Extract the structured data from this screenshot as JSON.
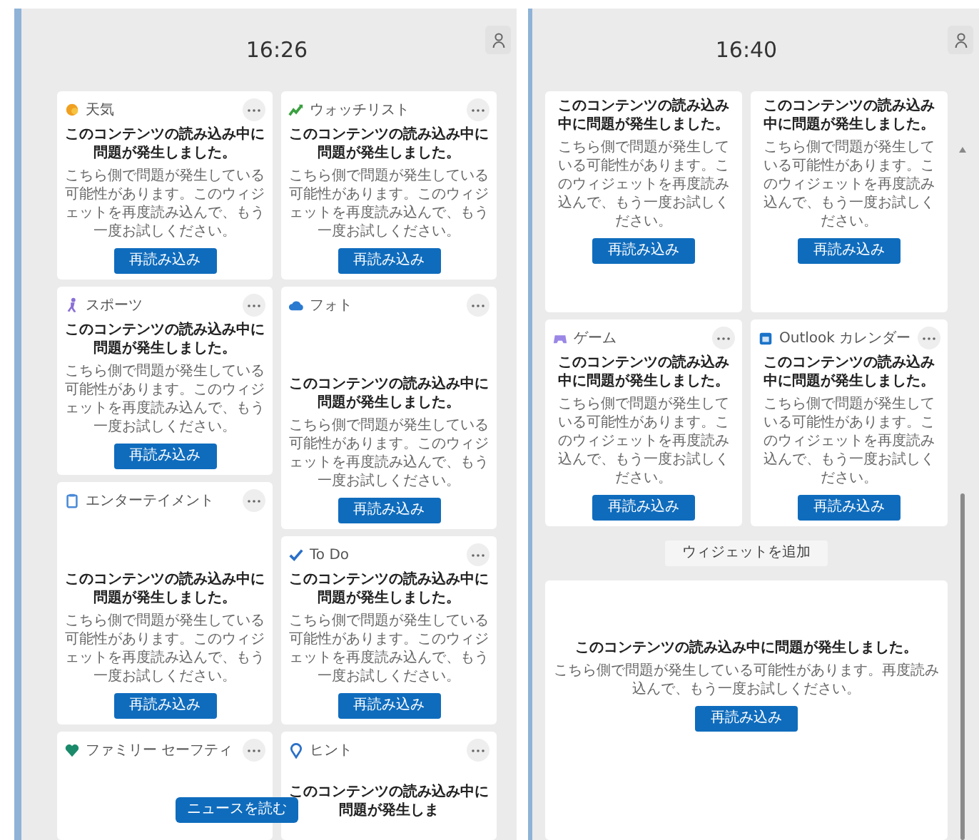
{
  "panels": [
    {
      "time": "16:26",
      "columns": [
        [
          {
            "kind": "standard",
            "name": "天気",
            "message": "このコンテンツの読み込み中に問題が発生しました。",
            "detail": "こちら側で問題が発生している可能性があります。このウィジェットを再度読み込んで、もう一度お試しください。",
            "button": "再読み込み"
          },
          {
            "kind": "standard",
            "name": "スポーツ",
            "message": "このコンテンツの読み込み中に問題が発生しました。",
            "detail": "こちら側で問題が発生している可能性があります。このウィジェットを再度読み込んで、もう一度お試しください。",
            "button": "再読み込み"
          },
          {
            "kind": "spaced_top",
            "name": "エンターテイメント",
            "message": "このコンテンツの読み込み中に問題が発生しました。",
            "detail": "こちら側で問題が発生している可能性があります。このウィジェットを再度読み込んで、もう一度お試しください。",
            "button": "再読み込み"
          },
          {
            "kind": "partial",
            "name": "ファミリー セーフティ"
          }
        ],
        [
          {
            "kind": "standard",
            "name": "ウォッチリスト",
            "message": "このコンテンツの読み込み中に問題が発生しました。",
            "detail": "こちら側で問題が発生している可能性があります。このウィジェットを再度読み込んで、もう一度お試しください。",
            "button": "再読み込み"
          },
          {
            "kind": "spaced_top",
            "name": "フォト",
            "message": "このコンテンツの読み込み中に問題が発生しました。",
            "detail": "こちら側で問題が発生している可能性があります。このウィジェットを再度読み込んで、もう一度お試しください。",
            "button": "再読み込み"
          },
          {
            "kind": "standard",
            "name": "To Do",
            "message": "このコンテンツの読み込み中に問題が発生しました。",
            "detail": "こちら側で問題が発生している可能性があります。このウィジェットを再度読み込んで、もう一度お試しください。",
            "button": "再読み込み"
          },
          {
            "kind": "partial",
            "name": "ヒント",
            "message": "このコンテンツの読み込み中に問題が発生しま"
          }
        ]
      ],
      "news_button": "ニュースを読む"
    },
    {
      "time": "16:40",
      "columns": [
        [
          {
            "kind": "spaced_bottom",
            "message": "このコンテンツの読み込み中に問題が発生しました。",
            "detail": "こちら側で問題が発生している可能性があります。このウィジェットを再度読み込んで、もう一度お試しください。",
            "button": "再読み込み"
          },
          {
            "kind": "standard",
            "name": "ゲーム",
            "message": "このコンテンツの読み込み中に問題が発生しました。",
            "detail": "こちら側で問題が発生している可能性があります。このウィジェットを再度読み込んで、もう一度お試しください。",
            "button": "再読み込み"
          }
        ],
        [
          {
            "kind": "spaced_bottom",
            "message": "このコンテンツの読み込み中に問題が発生しました。",
            "detail": "こちら側で問題が発生している可能性があります。このウィジェットを再度読み込んで、もう一度お試しください。",
            "button": "再読み込み"
          },
          {
            "kind": "standard",
            "name": "Outlook カレンダー",
            "message": "このコンテンツの読み込み中に問題が発生しました。",
            "detail": "こちら側で問題が発生している可能性があります。このウィジェットを再度読み込んで、もう一度お試しください。",
            "button": "再読み込み"
          }
        ]
      ],
      "add_widget_button": "ウィジェットを追加",
      "wide_card": {
        "message": "このコンテンツの読み込み中に問題が発生しました。",
        "detail": "こちら側で問題が発生している可能性があります。再度読み込んで、もう一度お試しください。",
        "button": "再読み込み"
      }
    }
  ]
}
